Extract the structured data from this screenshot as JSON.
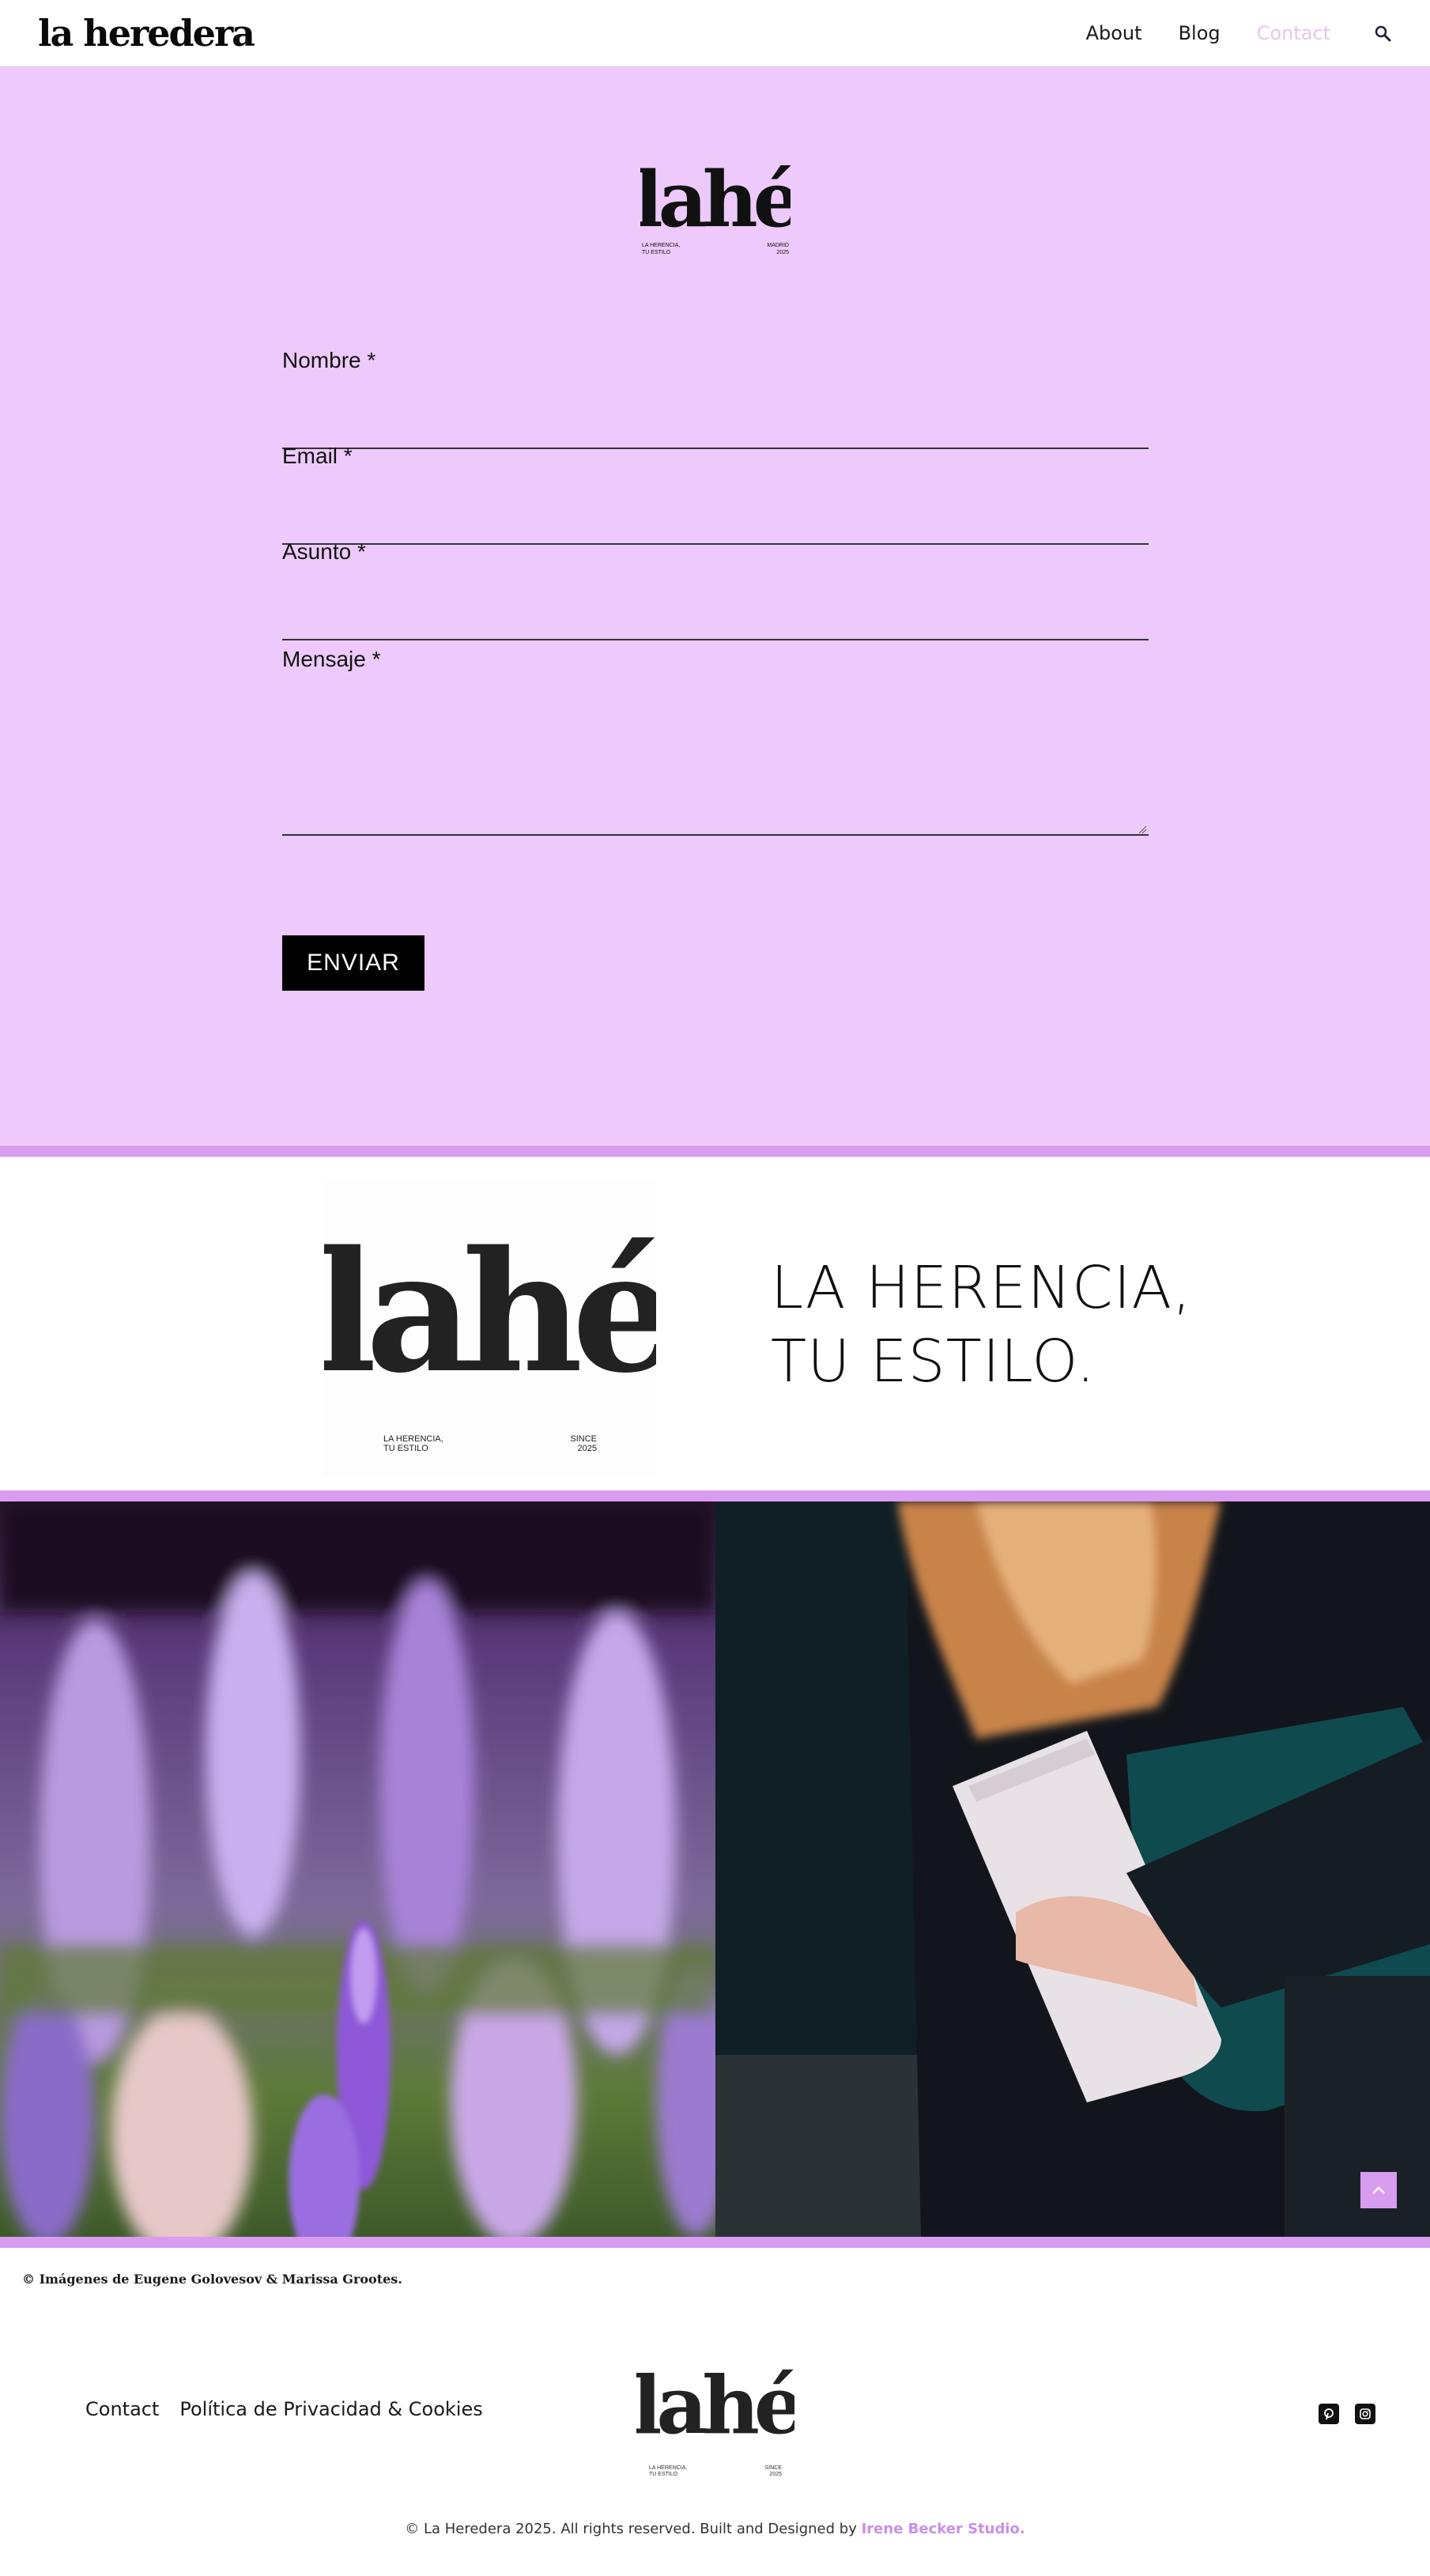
{
  "header": {
    "brand": "la heredera",
    "nav": [
      "About",
      "Blog",
      "Contact"
    ],
    "active_nav": "Contact"
  },
  "logo": {
    "word": "lahé",
    "left_line1": "LA HERENCIA,",
    "left_line2": "TU ESTILO",
    "right_line1": "MADRID",
    "right_line2": "2025",
    "since_line1": "SINCE",
    "since_line2": "2025"
  },
  "form": {
    "name_label": "Nombre *",
    "email_label": "Email *",
    "subject_label": "Asunto *",
    "message_label": "Mensaje *",
    "submit_label": "ENVIAR"
  },
  "tagline": {
    "line1": "LA HERENCIA,",
    "line2": "TU ESTILO."
  },
  "credit": "© Imágenes de Eugene Golovesov & Marissa Grootes.",
  "footer": {
    "links": [
      "Contact",
      "Política de Privacidad & Cookies"
    ],
    "copyright": "© La Heredera 2025. All rights reserved. Built and Designed by ",
    "studio": "Irene Becker Studio."
  },
  "colors": {
    "accent": "#edcafb",
    "band": "#d89cf0",
    "studio": "#c98fe6",
    "active_nav": "#e6c6ec"
  },
  "icons": [
    "search-icon",
    "arrow-up-icon",
    "pinterest-icon",
    "instagram-icon"
  ]
}
